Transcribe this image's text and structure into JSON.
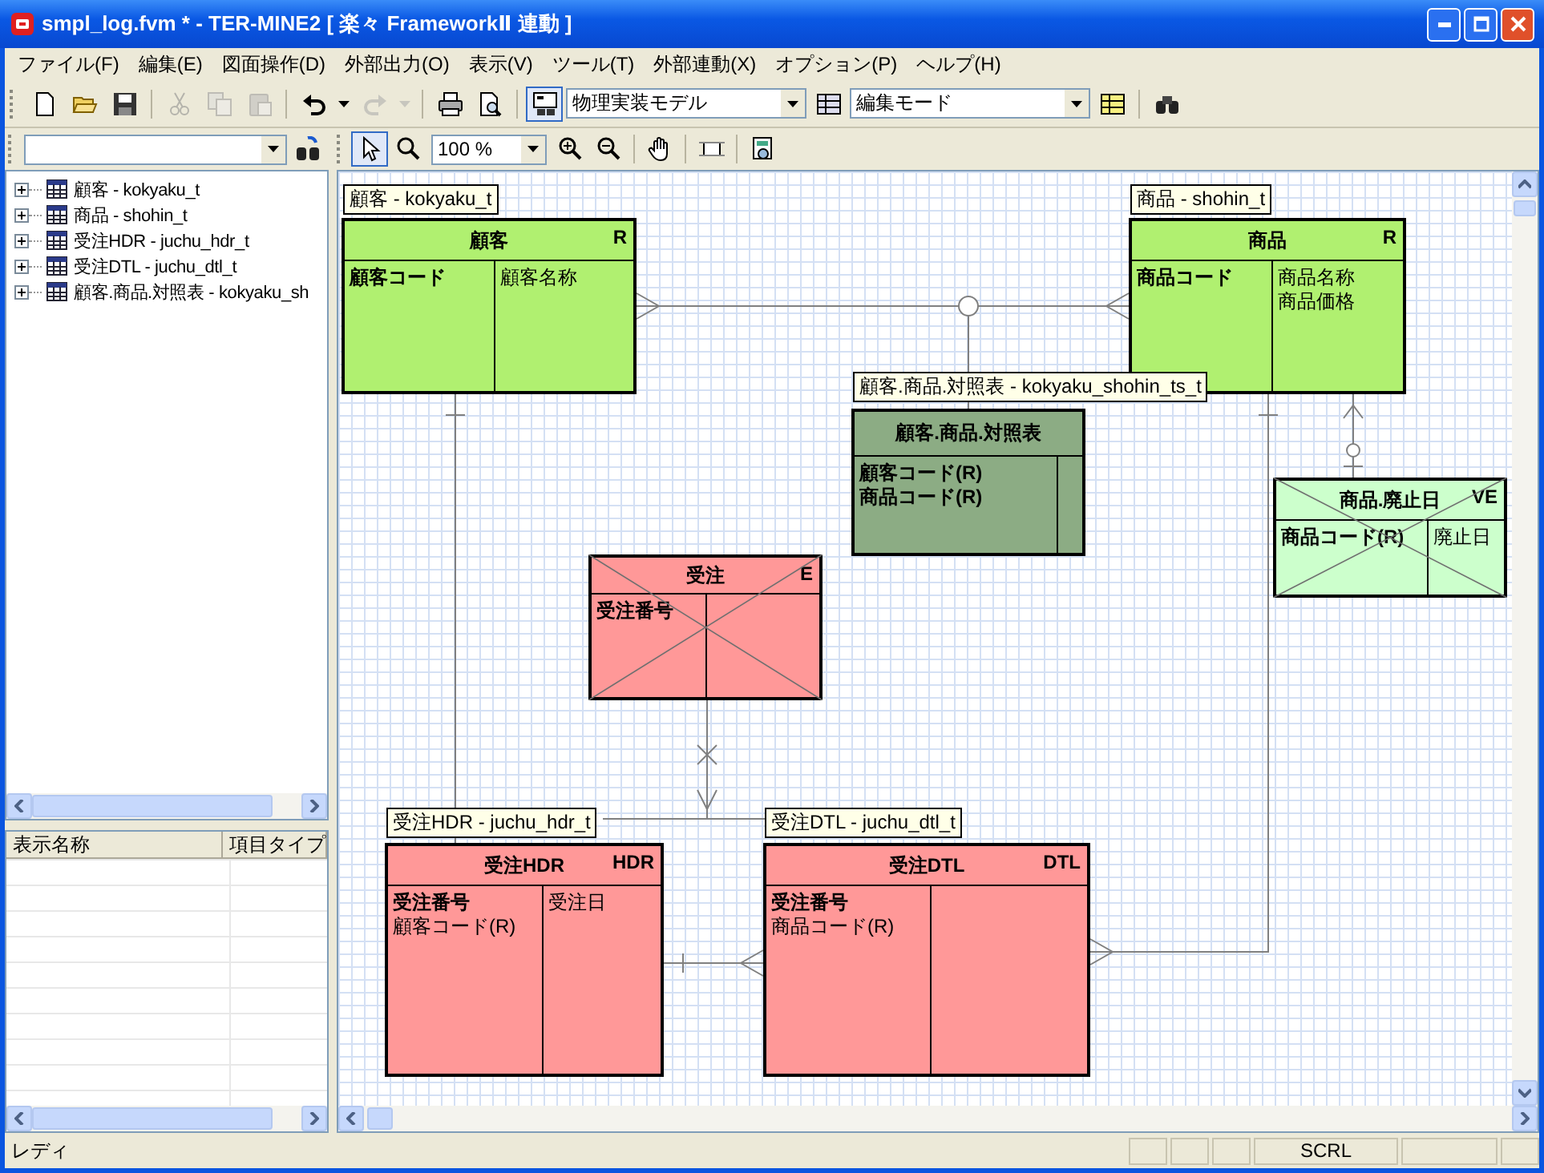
{
  "window": {
    "title": "smpl_log.fvm * - TER-MINE2 [ 楽々 FrameworkⅡ 連動 ]"
  },
  "menu": [
    "ファイル(F)",
    "編集(E)",
    "図面操作(D)",
    "外部出力(O)",
    "表示(V)",
    "ツール(T)",
    "外部連動(X)",
    "オプション(P)",
    "ヘルプ(H)"
  ],
  "toolbar": [
    {
      "kind": "new",
      "disabled": false,
      "selected": false
    },
    {
      "kind": "open",
      "disabled": false,
      "selected": false
    },
    {
      "kind": "save",
      "disabled": false,
      "selected": false
    },
    {
      "kind": "separator"
    },
    {
      "kind": "cut",
      "disabled": true,
      "selected": false
    },
    {
      "kind": "copy",
      "disabled": true,
      "selected": false
    },
    {
      "kind": "paste",
      "disabled": true,
      "selected": false
    },
    {
      "kind": "separator"
    },
    {
      "kind": "undo",
      "disabled": false,
      "selected": false
    },
    {
      "kind": "menu",
      "disabled": false,
      "selected": false
    },
    {
      "kind": "redo",
      "disabled": true,
      "selected": false
    },
    {
      "kind": "menu",
      "disabled": true,
      "selected": false
    },
    {
      "kind": "separator"
    },
    {
      "kind": "print",
      "disabled": false,
      "selected": false
    },
    {
      "kind": "preview",
      "disabled": false,
      "selected": false
    },
    {
      "kind": "separator"
    },
    {
      "kind": "diagram",
      "disabled": false,
      "selected": true
    },
    {
      "kind": "select",
      "value": "物理実装モデル"
    },
    {
      "kind": "model",
      "disabled": false,
      "selected": false
    },
    {
      "kind": "select",
      "value": "編集モード"
    },
    {
      "kind": "mode",
      "disabled": false,
      "selected": false
    },
    {
      "kind": "separator"
    },
    {
      "kind": "find",
      "disabled": false,
      "selected": false
    }
  ],
  "canvas_toolbar": [
    {
      "kind": "pointer",
      "selected": true
    },
    {
      "kind": "zoom",
      "selected": false
    },
    {
      "kind": "select",
      "value": "100 %"
    },
    {
      "kind": "zoom-in",
      "selected": false
    },
    {
      "kind": "zoom-out",
      "selected": false
    },
    {
      "kind": "separator"
    },
    {
      "kind": "hand",
      "selected": false
    },
    {
      "kind": "separator"
    },
    {
      "kind": "frame",
      "selected": false
    },
    {
      "kind": "separator"
    },
    {
      "kind": "export",
      "selected": false
    }
  ],
  "tree": [
    {
      "label": "顧客 - kokyaku_t",
      "expanded": false
    },
    {
      "label": "商品 - shohin_t",
      "expanded": false
    },
    {
      "label": "受注HDR - juchu_hdr_t",
      "expanded": false
    },
    {
      "label": "受注DTL - juchu_dtl_t",
      "expanded": false
    },
    {
      "label": "顧客.商品.対照表 - kokyaku_sh",
      "expanded": false
    }
  ],
  "property_grid": {
    "columns": [
      "表示名称",
      "項目タイプ"
    ]
  },
  "diagram": {
    "entities": [
      {
        "label": "顧客 - kokyaku_t",
        "name": "顧客",
        "tag": "R",
        "color": "#b0f070",
        "crossed": false,
        "keys": [
          "顧客コード"
        ],
        "attributes": [
          "顧客名称"
        ]
      },
      {
        "label": "商品 - shohin_t",
        "name": "商品",
        "tag": "R",
        "color": "#b0f070",
        "crossed": false,
        "keys": [
          "商品コード"
        ],
        "attributes": [
          "商品名称",
          "商品価格"
        ]
      },
      {
        "label": "顧客.商品.対照表 - kokyaku_shohin_ts_t",
        "name": "顧客.商品.対照表",
        "color": "#8cac84",
        "crossed": false,
        "keys": [
          "顧客コード(R)",
          "商品コード(R)"
        ]
      },
      {
        "name": "商品.廃止日",
        "tag": "VE",
        "color": "#ccffcc",
        "crossed": true,
        "keys": [
          "商品コード(R)"
        ],
        "attributes": [
          "廃止日"
        ]
      },
      {
        "name": "受注",
        "tag": "E",
        "color": "#ff9898",
        "crossed": true,
        "keys": [
          "受注番号"
        ]
      },
      {
        "label": "受注HDR - juchu_hdr_t",
        "name": "受注HDR",
        "tag": "HDR",
        "color": "#ff9898",
        "crossed": false,
        "keys": [
          "受注番号"
        ],
        "foreign": [
          "顧客コード(R)"
        ],
        "attributes": [
          "受注日"
        ]
      },
      {
        "label": "受注DTL - juchu_dtl_t",
        "name": "受注DTL",
        "tag": "DTL",
        "color": "#ff9898",
        "crossed": false,
        "keys": [
          "受注番号"
        ],
        "foreign": [
          "商品コード(R)"
        ]
      }
    ]
  },
  "status_bar": {
    "message": "レディ",
    "indicator": "SCRL"
  }
}
